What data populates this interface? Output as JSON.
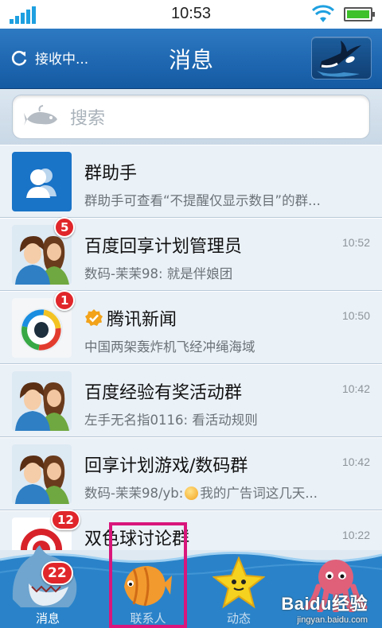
{
  "status_bar": {
    "time": "10:53",
    "battery_level": 1.0,
    "signal_bars": 5
  },
  "header": {
    "status_text": "接收中...",
    "title": "消息"
  },
  "search": {
    "placeholder": "搜索"
  },
  "conversations": [
    {
      "name": "群助手",
      "preview": "群助手可查看“不提醒仅显示数目”的群...",
      "time": "",
      "badge": "",
      "verified": false,
      "icon": "group-helper-icon"
    },
    {
      "name": "百度回享计划管理员",
      "preview": "数码-茉茉98: 就是伴娘团",
      "time": "10:52",
      "badge": "5",
      "verified": false,
      "icon": "couple-avatar-icon"
    },
    {
      "name": "腾讯新闻",
      "preview": "中国两架轰炸机飞经冲绳海域",
      "time": "10:50",
      "badge": "1",
      "verified": true,
      "icon": "tencent-news-logo-icon"
    },
    {
      "name": "百度经验有奖活动群",
      "preview": "左手无名指0116: 看活动规则",
      "time": "10:42",
      "badge": "",
      "verified": false,
      "icon": "couple-avatar-icon"
    },
    {
      "name": "回享计划游戏/数码群",
      "preview_before": "数码-茉茉98/yb:",
      "preview_after": "我的广告词这几天...",
      "time": "10:42",
      "badge": "",
      "verified": false,
      "icon": "couple-avatar-icon"
    },
    {
      "name": "双色球讨论群",
      "preview": "",
      "time": "10:22",
      "badge": "12",
      "verified": false,
      "icon": "lottery-logo-icon"
    }
  ],
  "tabs": [
    {
      "label": "消息",
      "badge": "22",
      "active": true,
      "icon": "shark-icon"
    },
    {
      "label": "联系人",
      "badge": "",
      "active": false,
      "icon": "fish-icon"
    },
    {
      "label": "动态",
      "badge": "",
      "active": false,
      "icon": "starfish-icon"
    },
    {
      "label": "",
      "badge": "",
      "active": false,
      "icon": "octopus-icon"
    }
  ],
  "watermark": {
    "brand": "Baidu经验",
    "url": "jingyan.baidu.com"
  },
  "colors": {
    "header": "#1f6bb5",
    "badge": "#e0262a",
    "highlight": "#d9167b",
    "tabbar": "#2a83c9"
  }
}
